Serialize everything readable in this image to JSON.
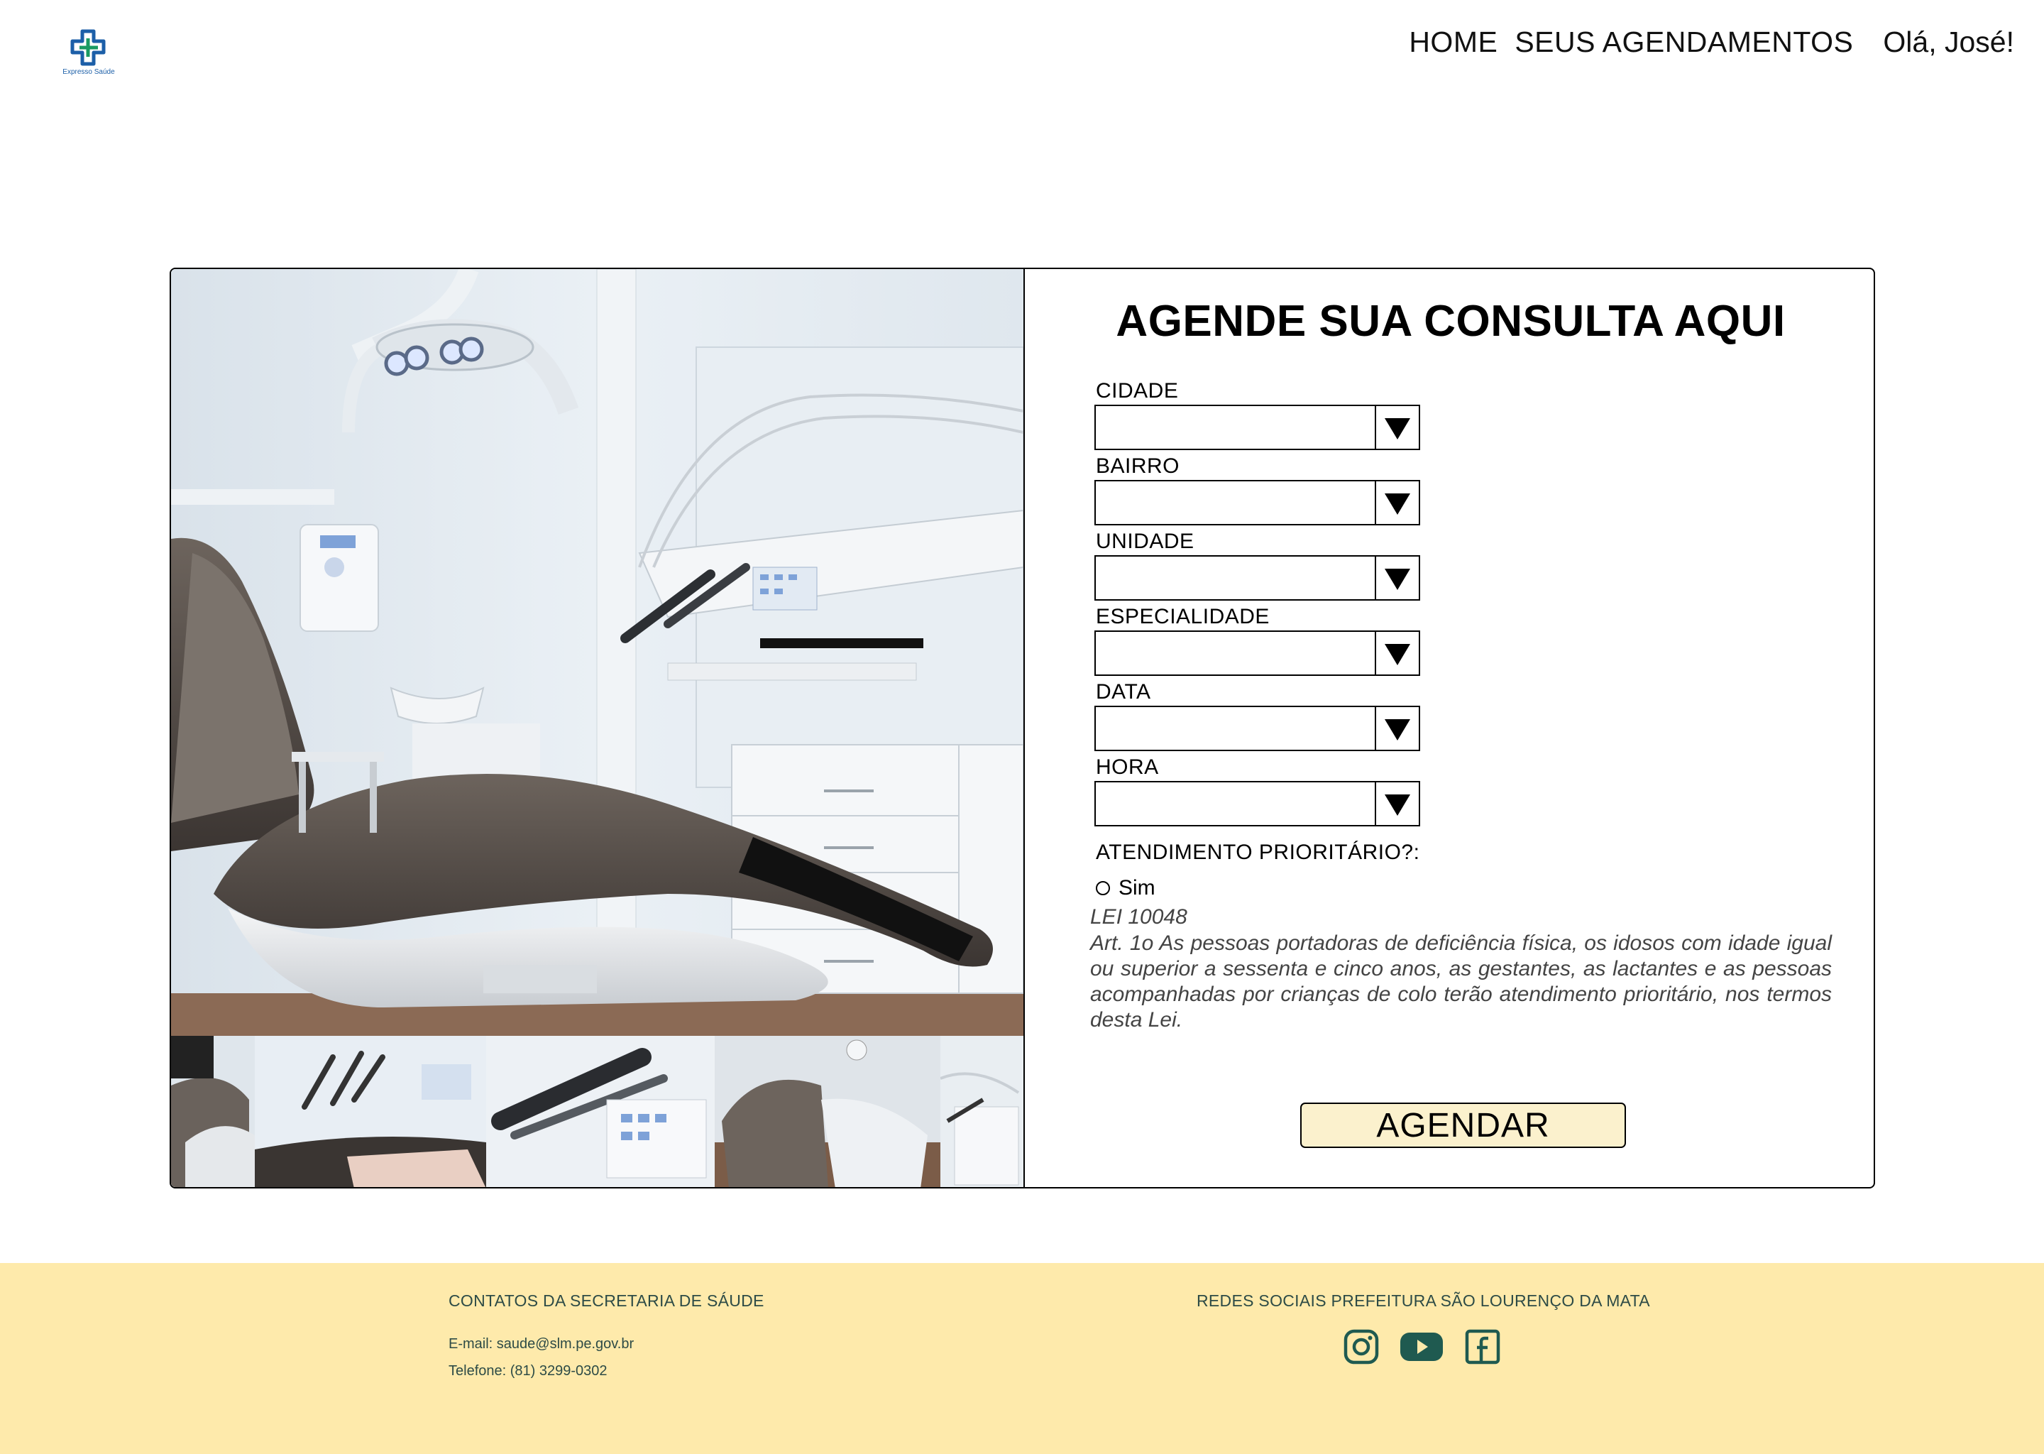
{
  "header": {
    "logo_text": "Expresso Saúde",
    "nav": {
      "home": "HOME",
      "appointments": "SEUS AGENDAMENTOS"
    },
    "greeting": "Olá, José!"
  },
  "form": {
    "title": "AGENDE SUA CONSULTA AQUI",
    "fields": [
      {
        "label": "CIDADE",
        "value": ""
      },
      {
        "label": "BAIRRO",
        "value": ""
      },
      {
        "label": "UNIDADE",
        "value": ""
      },
      {
        "label": "ESPECIALIDADE",
        "value": ""
      },
      {
        "label": "DATA",
        "value": ""
      },
      {
        "label": "HORA",
        "value": ""
      }
    ],
    "priority_label": "ATENDIMENTO PRIORITÁRIO?:",
    "priority_option": "Sim",
    "law_title": "LEI 10048",
    "law_text": "Art. 1o As pessoas portadoras de deficiência física, os idosos com idade igual ou superior a sessenta e cinco anos, as gestantes, as lactantes e as pessoas acompanhadas por crianças de colo terão atendimento prioritário, nos termos desta Lei.",
    "submit_label": "AGENDAR"
  },
  "footer": {
    "contacts_heading": "CONTATOS DA SECRETARIA DE SÁUDE",
    "email": "E-mail: saude@slm.pe.gov.br",
    "phone": "Telefone: (81) 3299-0302",
    "social_heading": "REDES SOCIAIS PREFEITURA SÃO LOURENÇO DA MATA",
    "social_icons": [
      "instagram-icon",
      "youtube-icon",
      "facebook-icon"
    ]
  },
  "colors": {
    "footer_bg": "#feeaab",
    "button_bg": "#fbf1cd",
    "footer_text": "#2d4b46",
    "logo_green": "#1a9a62",
    "logo_blue": "#1c5fa8"
  }
}
